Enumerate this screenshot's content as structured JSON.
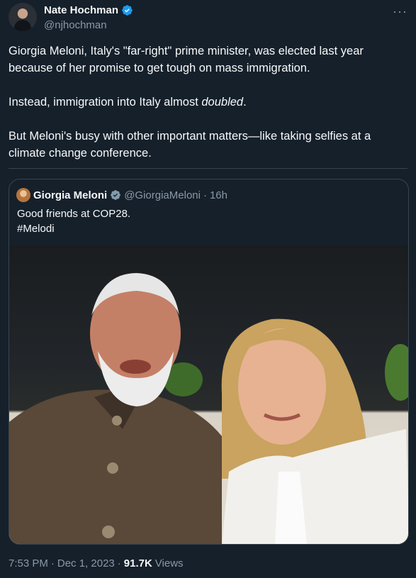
{
  "author": {
    "display_name": "Nate Hochman",
    "handle": "@njhochman",
    "more_glyph": "···"
  },
  "tweet": {
    "para1": "Giorgia Meloni, Italy's \"far-right\" prime minister, was elected last year because of her promise to get tough on mass immigration.",
    "para2_prefix": "Instead, immigration into Italy almost ",
    "para2_emph": "doubled",
    "para2_suffix": ".",
    "para3": "But Meloni's busy with other important matters—like taking selfies at a climate change conference."
  },
  "quoted": {
    "display_name": "Giorgia Meloni",
    "handle": "@GiorgiaMeloni",
    "separator": "·",
    "time": "16h",
    "line1": "Good friends at COP28.",
    "line2": "#Melodi"
  },
  "footer": {
    "time": "7:53 PM",
    "separator1": "·",
    "date": "Dec 1, 2023",
    "separator2": "·",
    "views_count": "91.7K",
    "views_label": "Views"
  },
  "colors": {
    "background": "#15202b",
    "verified": "#1d9bf0",
    "secondary_text": "#8b98a5"
  },
  "icons": {
    "verified": "verified-badge-icon",
    "more": "more-options-icon"
  }
}
